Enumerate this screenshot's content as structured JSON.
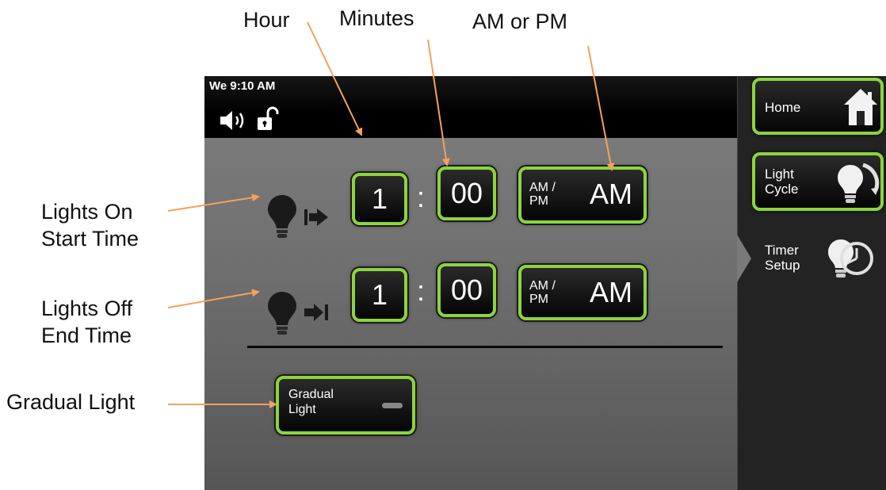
{
  "callouts": {
    "hour": "Hour",
    "minutes": "Minutes",
    "ampm": "AM or PM",
    "lights_on": [
      "Lights On",
      "Start Time"
    ],
    "lights_off": [
      "Lights Off",
      "End Time"
    ],
    "gradual": "Gradual Light"
  },
  "status_bar": {
    "clock": "We 9:10 AM",
    "icons": [
      "speaker-icon",
      "unlocked-padlock-icon"
    ]
  },
  "schedule": {
    "on": {
      "hour": "1",
      "separator": ":",
      "minutes": "00",
      "ampm_label": [
        "AM /",
        "PM"
      ],
      "ampm": "AM"
    },
    "off": {
      "hour": "1",
      "separator": ":",
      "minutes": "00",
      "ampm_label": [
        "AM /",
        "PM"
      ],
      "ampm": "AM"
    }
  },
  "gradual_light": {
    "label": [
      "Gradual",
      "Light"
    ],
    "state": "off"
  },
  "nav": {
    "home": "Home",
    "light_cycle": [
      "Light",
      "Cycle"
    ],
    "timer_setup": [
      "Timer",
      "Setup"
    ],
    "active": "timer_setup"
  },
  "colors": {
    "accent_green": "#8cd43e",
    "callout_arrow": "#f4a15d"
  }
}
